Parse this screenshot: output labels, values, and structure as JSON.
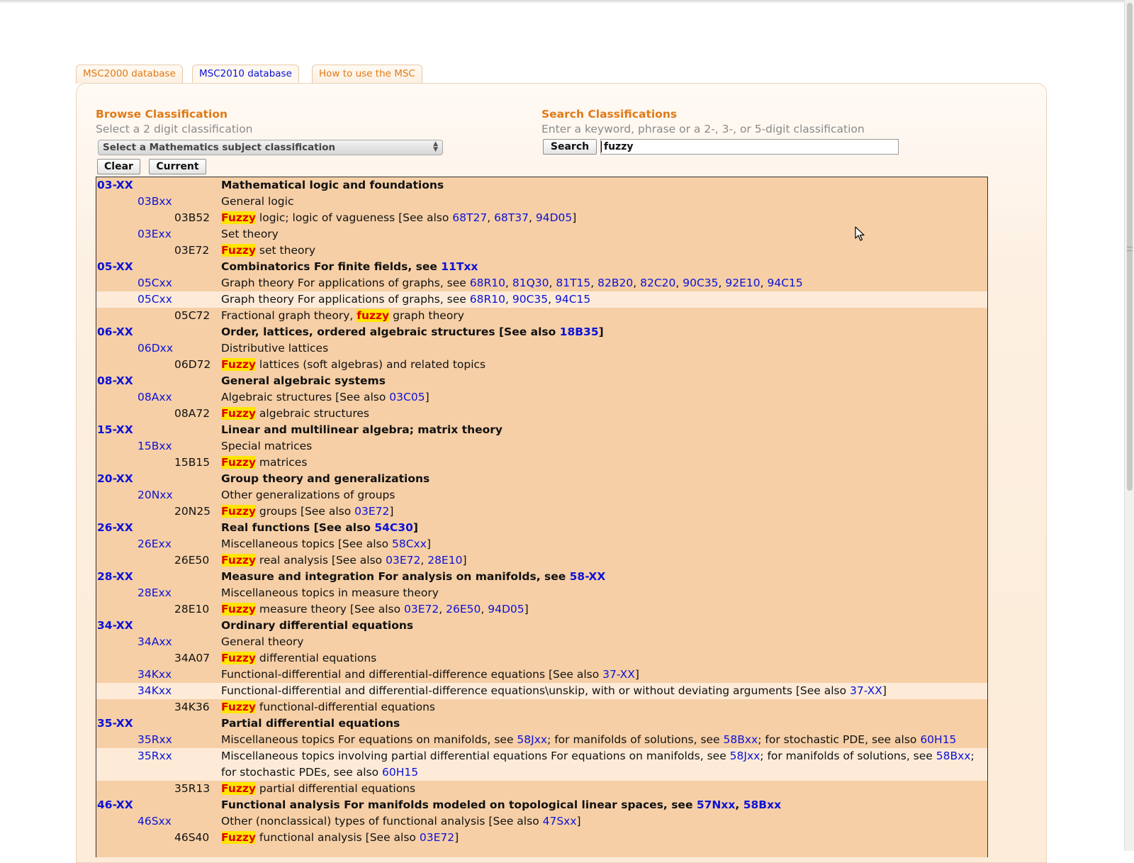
{
  "tabs": [
    {
      "label": "MSC2000 database",
      "active": false
    },
    {
      "label": "MSC2010 database",
      "active": true
    },
    {
      "label": "How to use the MSC",
      "active": false
    }
  ],
  "browse": {
    "title": "Browse Classification",
    "hint": "Select a 2 digit classification",
    "select_value": "Select a Mathematics subject classification",
    "clear_label": "Clear",
    "current_label": "Current"
  },
  "search": {
    "title": "Search Classifications",
    "hint": "Enter a keyword, phrase or a 2-, 3-, or 5-digit classification",
    "button_label": "Search",
    "query": "fuzzy"
  },
  "colors": {
    "accent_orange": "#e07a17",
    "link_blue": "#0b12d6",
    "row_bg": "#f6cfa6",
    "row_alt_bg": "#fdebd8",
    "highlight_bg": "#ffe500",
    "highlight_text": "#e00000"
  },
  "results": [
    {
      "code": "03-XX",
      "level": 0,
      "alt": false,
      "parts": [
        {
          "t": "Mathematical logic and foundations"
        }
      ]
    },
    {
      "code": "03Bxx",
      "level": 1,
      "alt": false,
      "parts": [
        {
          "t": "General logic"
        }
      ]
    },
    {
      "code": "03B52",
      "level": 2,
      "alt": false,
      "parts": [
        {
          "t": "Fuzzy",
          "hl": true
        },
        {
          "t": " logic; logic of vagueness [See also "
        },
        {
          "t": "68T27",
          "ref": true
        },
        {
          "t": ", "
        },
        {
          "t": "68T37",
          "ref": true
        },
        {
          "t": ", "
        },
        {
          "t": "94D05",
          "ref": true
        },
        {
          "t": "]"
        }
      ]
    },
    {
      "code": "03Exx",
      "level": 1,
      "alt": false,
      "parts": [
        {
          "t": "Set theory"
        }
      ]
    },
    {
      "code": "03E72",
      "level": 2,
      "alt": false,
      "parts": [
        {
          "t": "Fuzzy",
          "hl": true
        },
        {
          "t": " set theory"
        }
      ]
    },
    {
      "code": "05-XX",
      "level": 0,
      "alt": false,
      "parts": [
        {
          "t": "Combinatorics For finite fields, see "
        },
        {
          "t": "11Txx",
          "ref": true
        }
      ]
    },
    {
      "code": "05Cxx",
      "level": 1,
      "alt": false,
      "parts": [
        {
          "t": "Graph theory For applications of graphs, see "
        },
        {
          "t": "68R10",
          "ref": true
        },
        {
          "t": ", "
        },
        {
          "t": "81Q30",
          "ref": true
        },
        {
          "t": ", "
        },
        {
          "t": "81T15",
          "ref": true
        },
        {
          "t": ", "
        },
        {
          "t": "82B20",
          "ref": true
        },
        {
          "t": ", "
        },
        {
          "t": "82C20",
          "ref": true
        },
        {
          "t": ", "
        },
        {
          "t": "90C35",
          "ref": true
        },
        {
          "t": ", "
        },
        {
          "t": "92E10",
          "ref": true
        },
        {
          "t": ", "
        },
        {
          "t": "94C15",
          "ref": true
        }
      ]
    },
    {
      "code": "05Cxx",
      "level": 1,
      "alt": true,
      "parts": [
        {
          "t": "Graph theory For applications of graphs, see "
        },
        {
          "t": "68R10",
          "ref": true
        },
        {
          "t": ", "
        },
        {
          "t": "90C35",
          "ref": true
        },
        {
          "t": ", "
        },
        {
          "t": "94C15",
          "ref": true
        }
      ]
    },
    {
      "code": "05C72",
      "level": 2,
      "alt": false,
      "parts": [
        {
          "t": "Fractional graph theory, "
        },
        {
          "t": "fuzzy",
          "hl": true
        },
        {
          "t": " graph theory"
        }
      ]
    },
    {
      "code": "06-XX",
      "level": 0,
      "alt": false,
      "parts": [
        {
          "t": "Order, lattices, ordered algebraic structures [See also "
        },
        {
          "t": "18B35",
          "ref": true
        },
        {
          "t": "]"
        }
      ]
    },
    {
      "code": "06Dxx",
      "level": 1,
      "alt": false,
      "parts": [
        {
          "t": "Distributive lattices"
        }
      ]
    },
    {
      "code": "06D72",
      "level": 2,
      "alt": false,
      "parts": [
        {
          "t": "Fuzzy",
          "hl": true
        },
        {
          "t": " lattices (soft algebras) and related topics"
        }
      ]
    },
    {
      "code": "08-XX",
      "level": 0,
      "alt": false,
      "parts": [
        {
          "t": "General algebraic systems"
        }
      ]
    },
    {
      "code": "08Axx",
      "level": 1,
      "alt": false,
      "parts": [
        {
          "t": "Algebraic structures [See also "
        },
        {
          "t": "03C05",
          "ref": true
        },
        {
          "t": "]"
        }
      ]
    },
    {
      "code": "08A72",
      "level": 2,
      "alt": false,
      "parts": [
        {
          "t": "Fuzzy",
          "hl": true
        },
        {
          "t": " algebraic structures"
        }
      ]
    },
    {
      "code": "15-XX",
      "level": 0,
      "alt": false,
      "parts": [
        {
          "t": "Linear and multilinear algebra; matrix theory"
        }
      ]
    },
    {
      "code": "15Bxx",
      "level": 1,
      "alt": false,
      "parts": [
        {
          "t": "Special matrices"
        }
      ]
    },
    {
      "code": "15B15",
      "level": 2,
      "alt": false,
      "parts": [
        {
          "t": "Fuzzy",
          "hl": true
        },
        {
          "t": " matrices"
        }
      ]
    },
    {
      "code": "20-XX",
      "level": 0,
      "alt": false,
      "parts": [
        {
          "t": "Group theory and generalizations"
        }
      ]
    },
    {
      "code": "20Nxx",
      "level": 1,
      "alt": false,
      "parts": [
        {
          "t": "Other generalizations of groups"
        }
      ]
    },
    {
      "code": "20N25",
      "level": 2,
      "alt": false,
      "parts": [
        {
          "t": "Fuzzy",
          "hl": true
        },
        {
          "t": " groups [See also "
        },
        {
          "t": "03E72",
          "ref": true
        },
        {
          "t": "]"
        }
      ]
    },
    {
      "code": "26-XX",
      "level": 0,
      "alt": false,
      "parts": [
        {
          "t": "Real functions [See also "
        },
        {
          "t": "54C30",
          "ref": true
        },
        {
          "t": "]"
        }
      ]
    },
    {
      "code": "26Exx",
      "level": 1,
      "alt": false,
      "parts": [
        {
          "t": "Miscellaneous topics [See also "
        },
        {
          "t": "58Cxx",
          "ref": true
        },
        {
          "t": "]"
        }
      ]
    },
    {
      "code": "26E50",
      "level": 2,
      "alt": false,
      "parts": [
        {
          "t": "Fuzzy",
          "hl": true
        },
        {
          "t": " real analysis [See also "
        },
        {
          "t": "03E72",
          "ref": true
        },
        {
          "t": ", "
        },
        {
          "t": "28E10",
          "ref": true
        },
        {
          "t": "]"
        }
      ]
    },
    {
      "code": "28-XX",
      "level": 0,
      "alt": false,
      "parts": [
        {
          "t": "Measure and integration For analysis on manifolds, see "
        },
        {
          "t": "58-XX",
          "ref": true
        }
      ]
    },
    {
      "code": "28Exx",
      "level": 1,
      "alt": false,
      "parts": [
        {
          "t": "Miscellaneous topics in measure theory"
        }
      ]
    },
    {
      "code": "28E10",
      "level": 2,
      "alt": false,
      "parts": [
        {
          "t": "Fuzzy",
          "hl": true
        },
        {
          "t": " measure theory [See also "
        },
        {
          "t": "03E72",
          "ref": true
        },
        {
          "t": ", "
        },
        {
          "t": "26E50",
          "ref": true
        },
        {
          "t": ", "
        },
        {
          "t": "94D05",
          "ref": true
        },
        {
          "t": "]"
        }
      ]
    },
    {
      "code": "34-XX",
      "level": 0,
      "alt": false,
      "parts": [
        {
          "t": "Ordinary differential equations"
        }
      ]
    },
    {
      "code": "34Axx",
      "level": 1,
      "alt": false,
      "parts": [
        {
          "t": "General theory"
        }
      ]
    },
    {
      "code": "34A07",
      "level": 2,
      "alt": false,
      "parts": [
        {
          "t": "Fuzzy",
          "hl": true
        },
        {
          "t": " differential equations"
        }
      ]
    },
    {
      "code": "34Kxx",
      "level": 1,
      "alt": false,
      "parts": [
        {
          "t": "Functional-differential and differential-difference equations [See also "
        },
        {
          "t": "37-XX",
          "ref": true
        },
        {
          "t": "]"
        }
      ]
    },
    {
      "code": "34Kxx",
      "level": 1,
      "alt": true,
      "parts": [
        {
          "t": "Functional-differential and differential-difference equations\\unskip, with or without deviating arguments [See also "
        },
        {
          "t": "37-XX",
          "ref": true
        },
        {
          "t": "]"
        }
      ]
    },
    {
      "code": "34K36",
      "level": 2,
      "alt": false,
      "parts": [
        {
          "t": "Fuzzy",
          "hl": true
        },
        {
          "t": " functional-differential equations"
        }
      ]
    },
    {
      "code": "35-XX",
      "level": 0,
      "alt": false,
      "parts": [
        {
          "t": "Partial differential equations"
        }
      ]
    },
    {
      "code": "35Rxx",
      "level": 1,
      "alt": false,
      "parts": [
        {
          "t": "Miscellaneous topics For equations on manifolds, see "
        },
        {
          "t": "58Jxx",
          "ref": true
        },
        {
          "t": "; for manifolds of solutions, see "
        },
        {
          "t": "58Bxx",
          "ref": true
        },
        {
          "t": "; for stochastic PDE, see also "
        },
        {
          "t": "60H15",
          "ref": true
        }
      ]
    },
    {
      "code": "35Rxx",
      "level": 1,
      "alt": true,
      "parts": [
        {
          "t": "Miscellaneous topics involving partial differential equations For equations on manifolds, see "
        },
        {
          "t": "58Jxx",
          "ref": true
        },
        {
          "t": "; for manifolds of solutions, see "
        },
        {
          "t": "58Bxx",
          "ref": true
        },
        {
          "t": "; for stochastic PDEs, see also "
        },
        {
          "t": "60H15",
          "ref": true
        }
      ]
    },
    {
      "code": "35R13",
      "level": 2,
      "alt": false,
      "parts": [
        {
          "t": "Fuzzy",
          "hl": true
        },
        {
          "t": " partial differential equations"
        }
      ]
    },
    {
      "code": "46-XX",
      "level": 0,
      "alt": false,
      "parts": [
        {
          "t": "Functional analysis For manifolds modeled on topological linear spaces, see "
        },
        {
          "t": "57Nxx",
          "ref": true
        },
        {
          "t": ", "
        },
        {
          "t": "58Bxx",
          "ref": true
        }
      ]
    },
    {
      "code": "46Sxx",
      "level": 1,
      "alt": false,
      "parts": [
        {
          "t": "Other (nonclassical) types of functional analysis [See also "
        },
        {
          "t": "47Sxx",
          "ref": true
        },
        {
          "t": "]"
        }
      ]
    },
    {
      "code": "46S40",
      "level": 2,
      "alt": false,
      "parts": [
        {
          "t": "Fuzzy",
          "hl": true
        },
        {
          "t": " functional analysis [See also "
        },
        {
          "t": "03E72",
          "ref": true
        },
        {
          "t": "]"
        }
      ]
    }
  ]
}
